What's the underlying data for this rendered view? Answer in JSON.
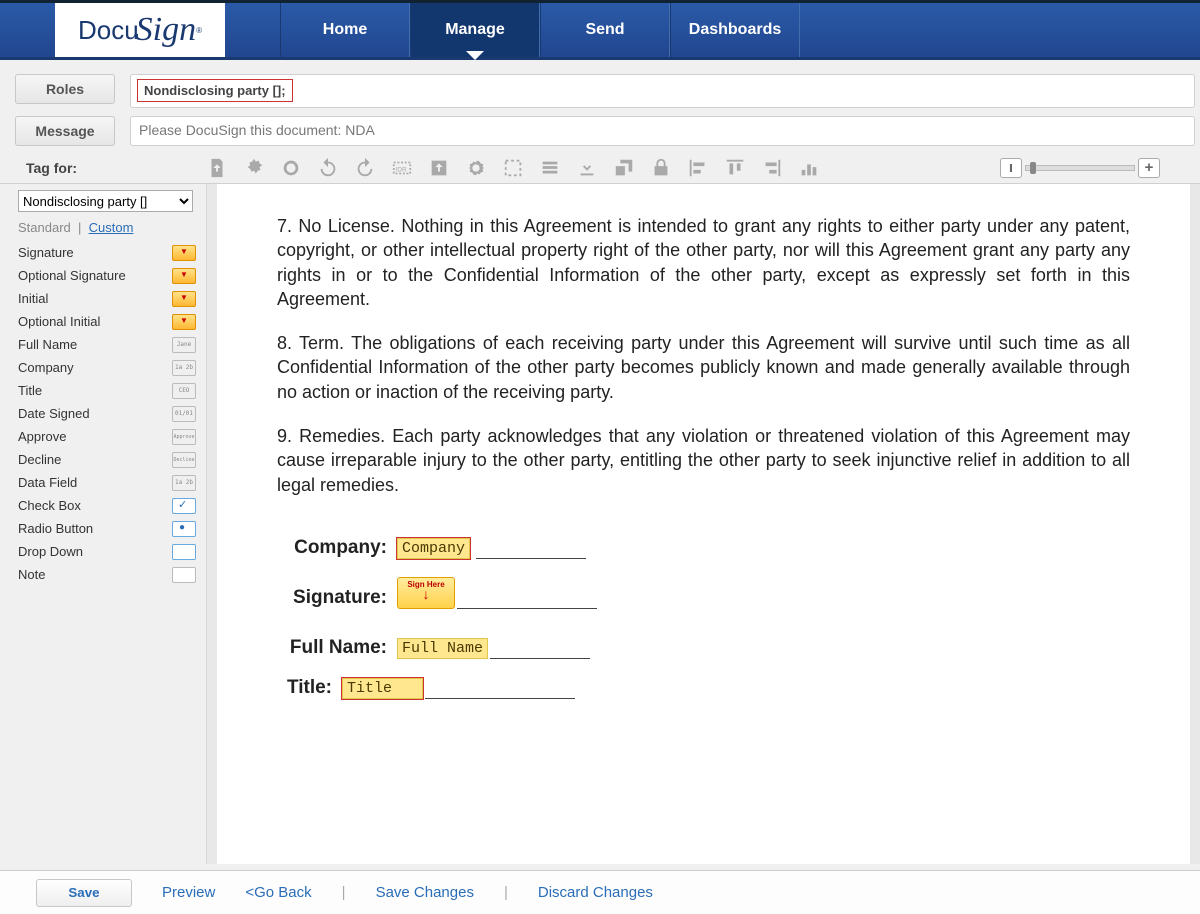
{
  "brand": {
    "a": "Docu",
    "b": "Sign"
  },
  "nav": {
    "home": "Home",
    "manage": "Manage",
    "send": "Send",
    "dashboards": "Dashboards"
  },
  "buttons": {
    "roles": "Roles",
    "message": "Message",
    "save": "Save"
  },
  "role_chip": "Nondisclosing party [];",
  "message_value": "Please DocuSign this document: NDA",
  "tag_for_label": "Tag for:",
  "tag_for_select": "Nondisclosing party []",
  "field_tabs": {
    "standard": "Standard",
    "custom": "Custom",
    "sep": "|"
  },
  "fields": {
    "signature": "Signature",
    "opt_signature": "Optional Signature",
    "initial": "Initial",
    "opt_initial": "Optional Initial",
    "full_name": "Full Name",
    "company": "Company",
    "title": "Title",
    "date_signed": "Date Signed",
    "approve": "Approve",
    "decline": "Decline",
    "data_field": "Data Field",
    "check_box": "Check Box",
    "radio": "Radio Button",
    "drop_down": "Drop Down",
    "note": "Note"
  },
  "doc": {
    "p7": "7. No License. Nothing in this Agreement is intended to grant any rights to either party under any patent, copyright, or other intellectual property right of the other party, nor will this Agreement grant any party any rights in or to the Confidential Information of the other party, except as expressly set forth in this Agreement.",
    "p8": "8. Term. The obligations of each receiving party under this Agreement will survive until such time as all Confidential Information of the other party becomes publicly known and made generally available through no action or inaction of the receiving party.",
    "p9": "9. Remedies. Each party acknowledges that any violation or threatened violation of this Agreement may cause irreparable injury to the other party, entitling the other party to seek injunctive relief in addition to all legal remedies.",
    "labels": {
      "company": "Company:",
      "signature": "Signature:",
      "full_name": "Full Name:",
      "title": "Title:"
    },
    "tags": {
      "company": "Company",
      "full_name": "Full Name",
      "title": "Title",
      "sign_here": "Sign Here"
    }
  },
  "footer": {
    "preview": "Preview",
    "go_back": "<Go Back",
    "save_changes": "Save Changes",
    "discard": "Discard Changes",
    "sep": "|"
  },
  "mini": {
    "jane": "Jane",
    "ceo": "CEO",
    "date": "01/01",
    "co": "1a 2b",
    "appr": "Approve",
    "decl": "Decline",
    "df": "1a 2b"
  }
}
